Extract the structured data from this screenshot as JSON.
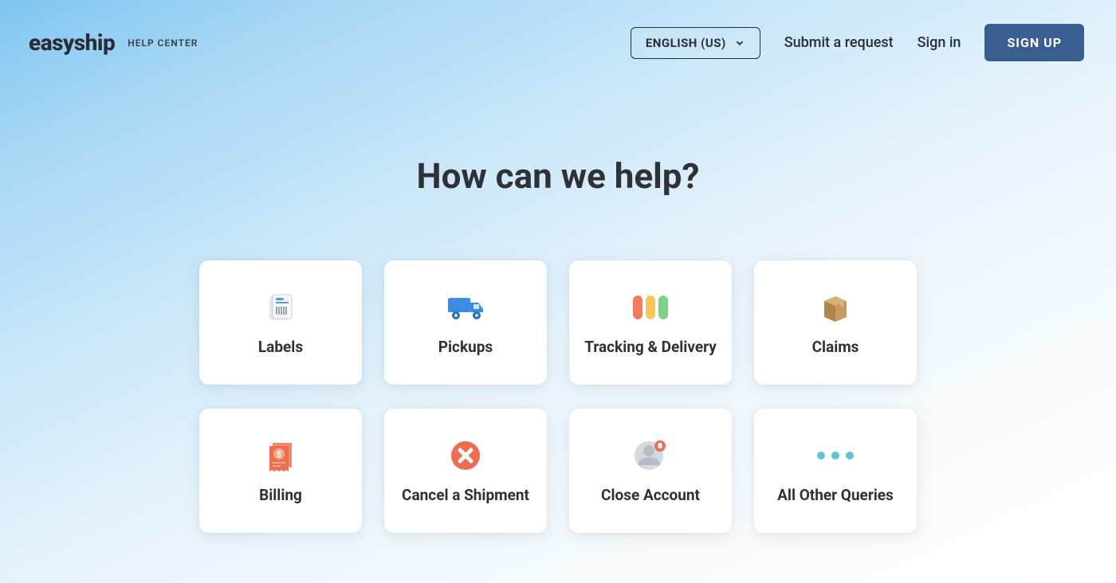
{
  "header": {
    "logo": "easyship",
    "help_label": "HELP CENTER",
    "language": "ENGLISH (US)",
    "submit_request": "Submit a request",
    "sign_in": "Sign in",
    "sign_up": "SIGN UP"
  },
  "hero": {
    "title": "How can we help?"
  },
  "cards": [
    {
      "label": "Labels",
      "icon": "labels"
    },
    {
      "label": "Pickups",
      "icon": "pickups"
    },
    {
      "label": "Tracking & Delivery",
      "icon": "tracking"
    },
    {
      "label": "Claims",
      "icon": "claims"
    },
    {
      "label": "Billing",
      "icon": "billing"
    },
    {
      "label": "Cancel a Shipment",
      "icon": "cancel"
    },
    {
      "label": "Close Account",
      "icon": "close_account"
    },
    {
      "label": "All Other Queries",
      "icon": "other"
    }
  ]
}
